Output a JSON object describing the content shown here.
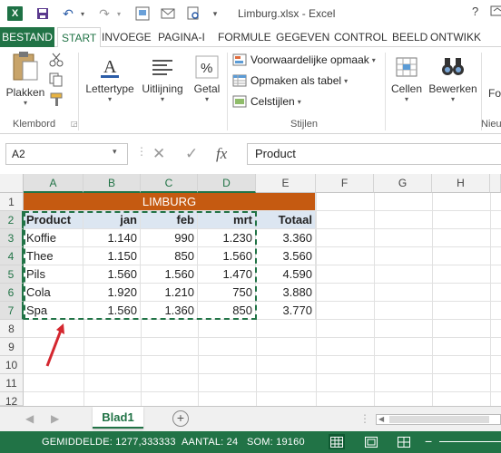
{
  "window": {
    "title": "Limburg.xlsx - Excel",
    "help": "?"
  },
  "tabs": [
    "BESTAND",
    "START",
    "INVOEGE",
    "PAGINA-I",
    "FORMULE",
    "GEGEVEN",
    "CONTROL",
    "BEELD",
    "ONTWIKK"
  ],
  "ribbon": {
    "paste": "Plakken",
    "font": "Lettertype",
    "align": "Uitlijning",
    "number": "Getal",
    "conditional": "Voorwaardelijke opmaak",
    "table": "Opmaken als tabel",
    "cellstyles": "Celstijlen",
    "cells": "Cellen",
    "edit": "Bewerken",
    "fo": "Fo",
    "group_clipboard": "Klembord",
    "group_styles": "Stijlen",
    "group_new": "Nieu"
  },
  "formula": {
    "namebox": "A2",
    "fx": "fx",
    "value": "Product"
  },
  "columns": [
    "A",
    "B",
    "C",
    "D",
    "E",
    "F",
    "G",
    "H"
  ],
  "rows": [
    "1",
    "2",
    "3",
    "4",
    "5",
    "6",
    "7",
    "8",
    "9",
    "10",
    "11",
    "12"
  ],
  "sheet": {
    "band": "LIMBURG",
    "headers": [
      "Product",
      "jan",
      "feb",
      "mrt",
      "Totaal"
    ],
    "data": [
      [
        "Koffie",
        "1.140",
        "990",
        "1.230",
        "3.360"
      ],
      [
        "Thee",
        "1.150",
        "850",
        "1.560",
        "3.560"
      ],
      [
        "Pils",
        "1.560",
        "1.560",
        "1.470",
        "4.590"
      ],
      [
        "Cola",
        "1.920",
        "1.210",
        "750",
        "3.880"
      ],
      [
        "Spa",
        "1.560",
        "1.360",
        "850",
        "3.770"
      ]
    ]
  },
  "sheettab": "Blad1",
  "status": {
    "average": "GEMIDDELDE: 1277,333333",
    "count": "AANTAL: 24",
    "sum": "SOM: 19160"
  },
  "colors": {
    "excel_green": "#217346",
    "band_orange": "#c55a11",
    "header_fill": "#dce6f1"
  }
}
